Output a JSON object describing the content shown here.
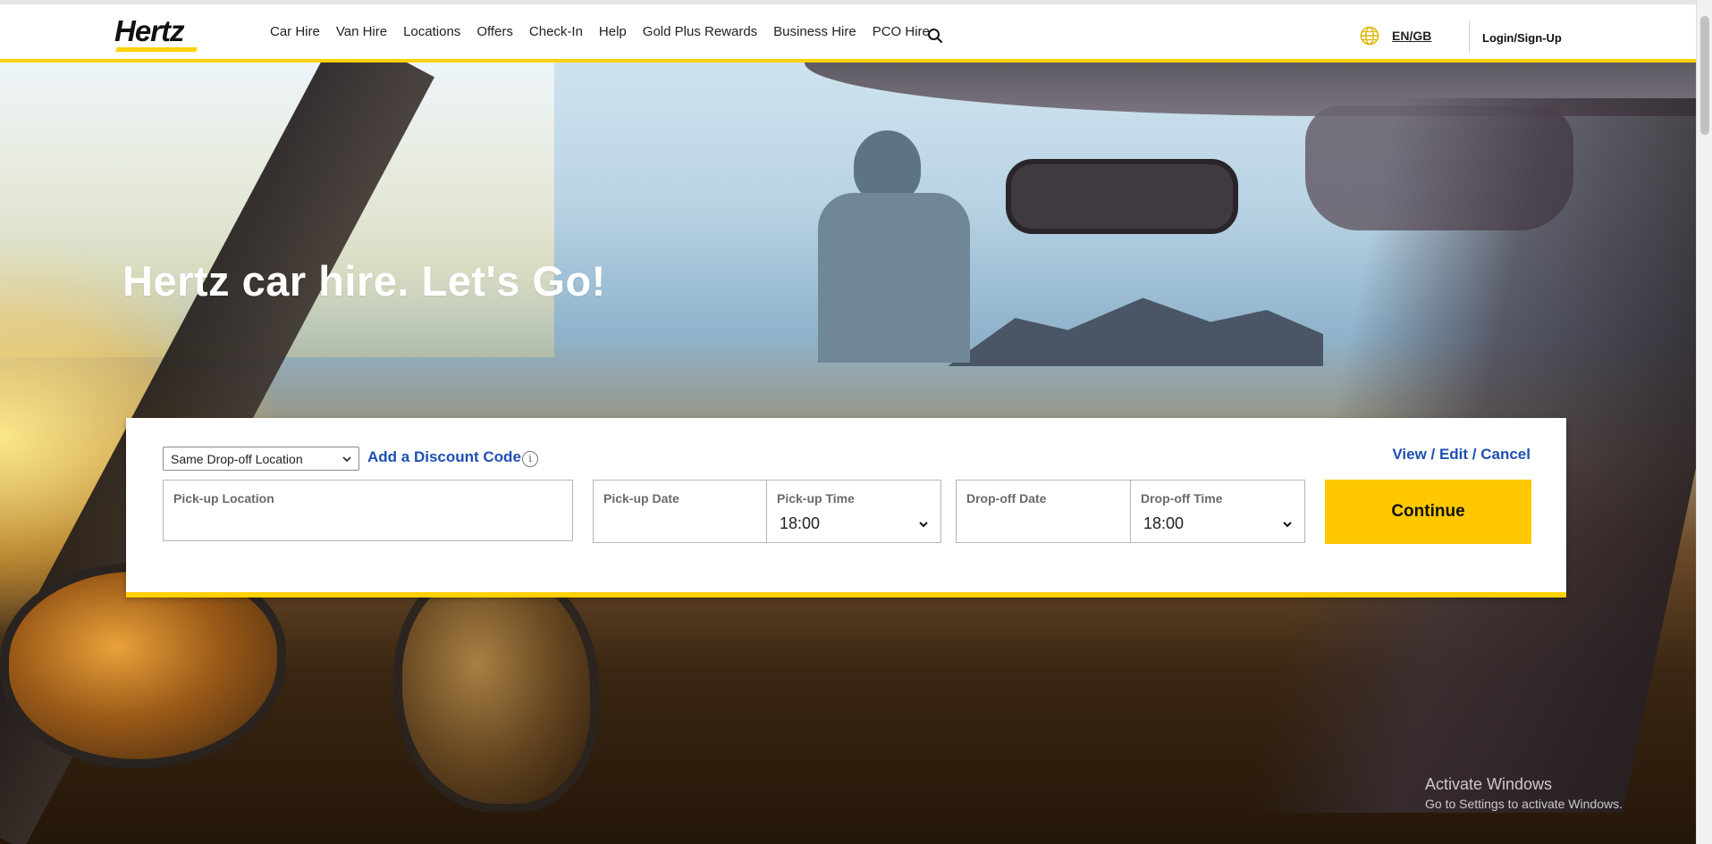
{
  "brand": {
    "logo_text": "Hertz",
    "accent": "#ffd100",
    "button_color": "#ffc800",
    "link_color": "#1e4fb4"
  },
  "nav": {
    "items": [
      {
        "label": "Car Hire"
      },
      {
        "label": "Van Hire"
      },
      {
        "label": "Locations"
      },
      {
        "label": "Offers"
      },
      {
        "label": "Check-In"
      },
      {
        "label": "Help"
      },
      {
        "label": "Gold Plus Rewards"
      },
      {
        "label": "Business Hire"
      },
      {
        "label": "PCO Hire"
      }
    ],
    "search_icon": "search-icon",
    "language": "EN/GB",
    "globe_icon": "globe-icon",
    "login": "Login/Sign-Up"
  },
  "hero": {
    "title": "Hertz car hire. Let's Go!"
  },
  "booking": {
    "dropoff_select": "Same Drop-off Location",
    "discount_link": "Add a Discount Code",
    "info_icon": "i",
    "view_link": "View / Edit / Cancel",
    "pickup_location": {
      "label": "Pick-up Location",
      "value": ""
    },
    "pickup_date": {
      "label": "Pick-up Date",
      "value": ""
    },
    "pickup_time": {
      "label": "Pick-up Time",
      "value": "18:00"
    },
    "dropoff_date": {
      "label": "Drop-off Date",
      "value": ""
    },
    "dropoff_time": {
      "label": "Drop-off Time",
      "value": "18:00"
    },
    "continue": "Continue"
  },
  "watermark": {
    "title": "Activate Windows",
    "subtitle": "Go to Settings to activate Windows."
  }
}
